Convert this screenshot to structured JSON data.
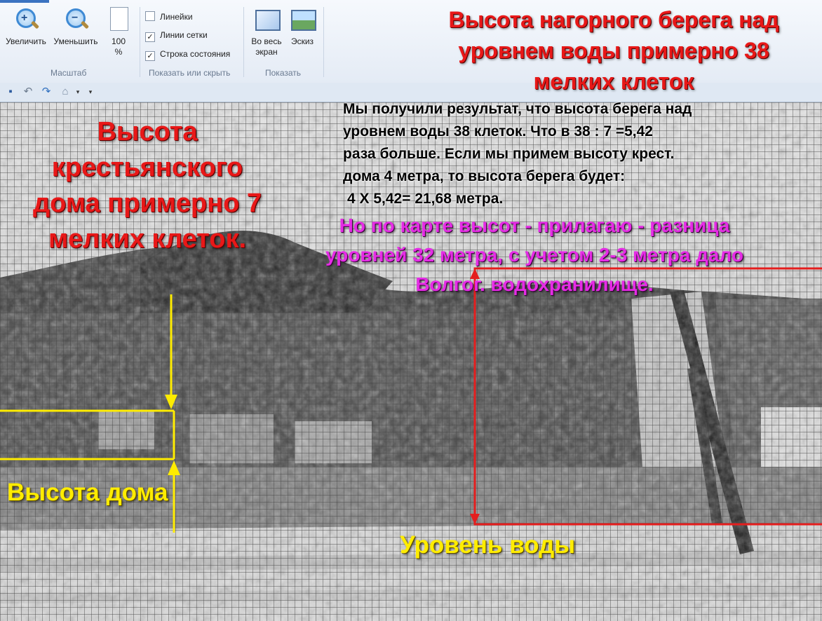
{
  "ribbon": {
    "zoom": {
      "zoom_in": "Увеличить",
      "zoom_out": "Уменьшить",
      "hundred": "100",
      "hundred_unit": "%",
      "caption": "Масштаб"
    },
    "show_hide": {
      "rulers": "Линейки",
      "gridlines": "Линии сетки",
      "statusbar": "Строка состояния",
      "caption": "Показать или скрыть",
      "rulers_checked": false,
      "gridlines_checked": true,
      "statusbar_checked": true
    },
    "display": {
      "fullscreen_1": "Во весь",
      "fullscreen_2": "экран",
      "thumbnail": "Эскиз",
      "caption": "Показать"
    }
  },
  "annotations": {
    "top_title": [
      "Высота нагорного берега над",
      "уровнем воды примерно 38",
      "мелких клеток"
    ],
    "house_title": [
      "Высота",
      "крестьянского",
      "дома примерно 7",
      "мелких клеток."
    ],
    "calculation": [
      "Мы получили результат, что высота берега над",
      "уровнем воды 38 клеток.  Что в 38 : 7 =5,42",
      "раза больше. Если мы примем высоту крест.",
      "дома 4 метра, то высота берега будет:",
      "4 Х 5,42= 21,68 метра."
    ],
    "map_note": [
      "Но по карте высот - прилагаю - разница",
      "уровней 32 метра, с учетом 2-3 метра дало",
      "Волгог. водохранилище."
    ],
    "house_height_label": "Высота дома",
    "water_level_label": "Уровень воды"
  },
  "colors": {
    "red_annotation": "#e81818",
    "yellow_marker": "#ffec00",
    "magenta_note": "#e52ce5",
    "red_frame": "#e41e1e"
  }
}
